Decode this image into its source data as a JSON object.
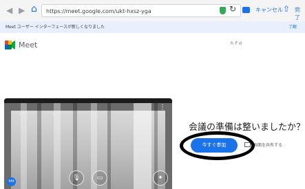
{
  "browser": {
    "back_glyph": "◀",
    "forward_glyph": "▶",
    "home_glyph": "⌂",
    "url": "https://meet.google.com/ukt-hxsz-yga",
    "reload_glyph": "↻",
    "cancel_label": "キャンセル",
    "share_glyph": "⇧",
    "more_label": "完了"
  },
  "banner": {
    "message": "Meet ユーザー インターフェースが新しくなりました",
    "action": "了解"
  },
  "meet": {
    "brand": "Meet",
    "account": "ｈｆｄ",
    "ready_prompt": "会議の準備は整いましたか？",
    "join_label": "今すぐ参加",
    "present_label": "画面を共有する",
    "preview_menu_glyph": "⋮",
    "mic_glyph": "🎙",
    "cam_glyph": "▭",
    "effects_glyph": "✦",
    "badge_label": "hfd"
  },
  "colors": {
    "accent": "#1a73e8",
    "banner_bg": "#e8f0fe",
    "annotation": "#000000"
  }
}
